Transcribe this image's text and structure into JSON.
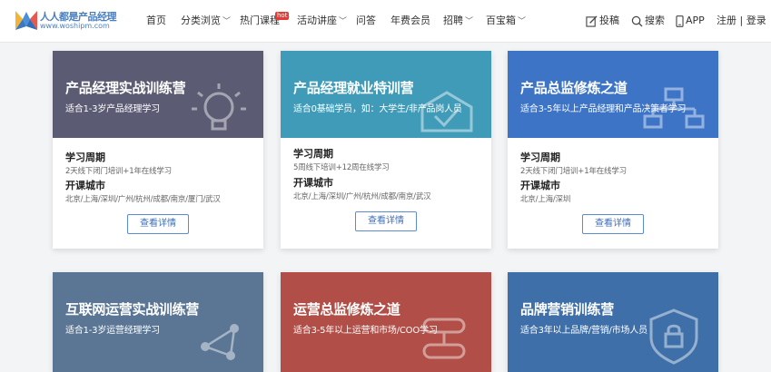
{
  "logo": {
    "name_cn": "人人都是产品经理",
    "url_text": "www.woshipm.com",
    "colors": [
      "#f4b433",
      "#4a90d9",
      "#e8584f"
    ]
  },
  "nav": [
    {
      "label": "首页",
      "caret": false
    },
    {
      "label": "分类浏览",
      "caret": true
    },
    {
      "label": "热门课程",
      "caret": true,
      "badge": "hot"
    },
    {
      "label": "活动讲座",
      "caret": true
    },
    {
      "label": "问答",
      "caret": false
    },
    {
      "label": "年费会员",
      "caret": false
    },
    {
      "label": "招聘",
      "caret": true
    },
    {
      "label": "百宝箱",
      "caret": true
    }
  ],
  "header_right": {
    "contribute": "投稿",
    "search": "搜索",
    "app": "APP",
    "register": "注册",
    "separator": "|",
    "login": "登录"
  },
  "cards": [
    {
      "title": "产品经理实战训练营",
      "subtitle": "适合1-3岁产品经理学习",
      "color": "#5b5b74",
      "icon": "lightbulb-icon",
      "period_label": "学习周期",
      "period": "2天线下闭门培训+1年在线学习",
      "city_label": "开课城市",
      "cities": "北京/上海/深圳/广州/杭州/成都/南京/厦门/武汉",
      "button": "查看详情"
    },
    {
      "title": "产品经理就业特训营",
      "subtitle": "适合0基础学员，如：大学生/非产品岗人员",
      "color": "#3f9bb8",
      "icon": "shield-check-icon",
      "period_label": "学习周期",
      "period": "5周线下培训+12周在线学习",
      "city_label": "开课城市",
      "cities": "北京/上海/深圳/广州/杭州/成都/南京/武汉",
      "button": "查看详情"
    },
    {
      "title": "产品总监修炼之道",
      "subtitle": "适合3-5年以上产品经理和产品决策者学习",
      "color": "#3d74c6",
      "icon": "org-chart-icon",
      "period_label": "学习周期",
      "period": "2天线下闭门培训+1年在线学习",
      "city_label": "开课城市",
      "cities": "北京/上海/深圳",
      "button": "查看详情"
    },
    {
      "title": "互联网运营实战训练营",
      "subtitle": "适合1-3岁运营经理学习",
      "color": "#5a7694",
      "icon": "network-icon"
    },
    {
      "title": "运营总监修炼之道",
      "subtitle": "适合3-5年以上运营和市场/COO学习",
      "color": "#b04e47",
      "icon": "flow-icon"
    },
    {
      "title": "品牌营销训练营",
      "subtitle": "适合3年以上品牌/营销/市场人员",
      "color": "#3f6fa8",
      "icon": "shield-icon"
    }
  ]
}
